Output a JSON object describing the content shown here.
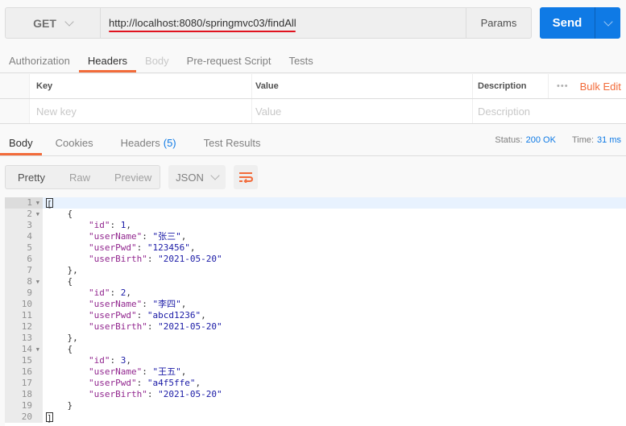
{
  "request": {
    "method": "GET",
    "url": "http://localhost:8080/springmvc03/findAll",
    "params_label": "Params",
    "send_label": "Send"
  },
  "request_tabs": [
    {
      "label": "Authorization",
      "state": "normal"
    },
    {
      "label": "Headers",
      "state": "active"
    },
    {
      "label": "Body",
      "state": "disabled"
    },
    {
      "label": "Pre-request Script",
      "state": "normal"
    },
    {
      "label": "Tests",
      "state": "normal"
    }
  ],
  "headers_table": {
    "columns": {
      "key": "Key",
      "value": "Value",
      "description": "Description"
    },
    "more": "•••",
    "bulk_edit": "Bulk Edit",
    "placeholders": {
      "key": "New key",
      "value": "Value",
      "description": "Description"
    }
  },
  "response_tabs": [
    {
      "label": "Body"
    },
    {
      "label": "Cookies"
    },
    {
      "label": "Headers",
      "count": "(5)"
    },
    {
      "label": "Test Results"
    }
  ],
  "status": {
    "status_label": "Status:",
    "status_value": "200 OK",
    "time_label": "Time:",
    "time_value": "31 ms"
  },
  "format": {
    "modes": [
      "Pretty",
      "Raw",
      "Preview"
    ],
    "active": "Pretty",
    "type": "JSON"
  },
  "colors": {
    "accent": "#f26b3a",
    "send": "#0f7ae5"
  },
  "code_lines": [
    {
      "n": "1",
      "fold": true,
      "html": "[",
      "cursor": true
    },
    {
      "n": "2",
      "fold": true,
      "t": "    {"
    },
    {
      "n": "3",
      "k": "\"id\"",
      "v": "1",
      "vt": "n",
      "comma": ","
    },
    {
      "n": "4",
      "k": "\"userName\"",
      "v": "\"张三\"",
      "vt": "s",
      "comma": ","
    },
    {
      "n": "5",
      "k": "\"userPwd\"",
      "v": "\"123456\"",
      "vt": "s",
      "comma": ","
    },
    {
      "n": "6",
      "k": "\"userBirth\"",
      "v": "\"2021-05-20\"",
      "vt": "s",
      "comma": ""
    },
    {
      "n": "7",
      "t": "    },"
    },
    {
      "n": "8",
      "fold": true,
      "t": "    {"
    },
    {
      "n": "9",
      "k": "\"id\"",
      "v": "2",
      "vt": "n",
      "comma": ","
    },
    {
      "n": "10",
      "k": "\"userName\"",
      "v": "\"李四\"",
      "vt": "s",
      "comma": ","
    },
    {
      "n": "11",
      "k": "\"userPwd\"",
      "v": "\"abcd1236\"",
      "vt": "s",
      "comma": ","
    },
    {
      "n": "12",
      "k": "\"userBirth\"",
      "v": "\"2021-05-20\"",
      "vt": "s",
      "comma": ""
    },
    {
      "n": "13",
      "t": "    },"
    },
    {
      "n": "14",
      "fold": true,
      "t": "    {"
    },
    {
      "n": "15",
      "k": "\"id\"",
      "v": "3",
      "vt": "n",
      "comma": ","
    },
    {
      "n": "16",
      "k": "\"userName\"",
      "v": "\"王五\"",
      "vt": "s",
      "comma": ","
    },
    {
      "n": "17",
      "k": "\"userPwd\"",
      "v": "\"a4f5ffe\"",
      "vt": "s",
      "comma": ","
    },
    {
      "n": "18",
      "k": "\"userBirth\"",
      "v": "\"2021-05-20\"",
      "vt": "s",
      "comma": ""
    },
    {
      "n": "19",
      "t": "    }"
    },
    {
      "n": "20",
      "t": "]",
      "cursor": true
    }
  ]
}
